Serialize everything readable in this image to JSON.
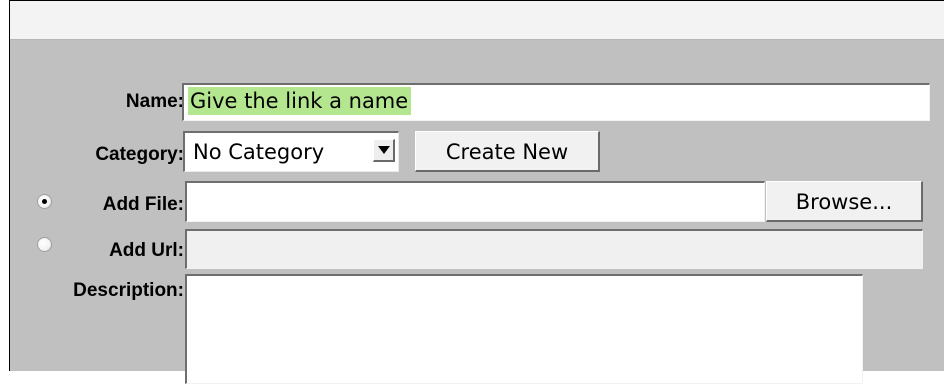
{
  "form": {
    "name": {
      "label": "Name:",
      "value": "Give the link a name"
    },
    "category": {
      "label": "Category:",
      "selected": "No Category",
      "create_label": "Create New"
    },
    "add_file": {
      "label": "Add File:",
      "selected": true,
      "value": "",
      "browse_label": "Browse..."
    },
    "add_url": {
      "label": "Add Url:",
      "selected": false,
      "value": ""
    },
    "description": {
      "label": "Description:",
      "value": ""
    }
  }
}
